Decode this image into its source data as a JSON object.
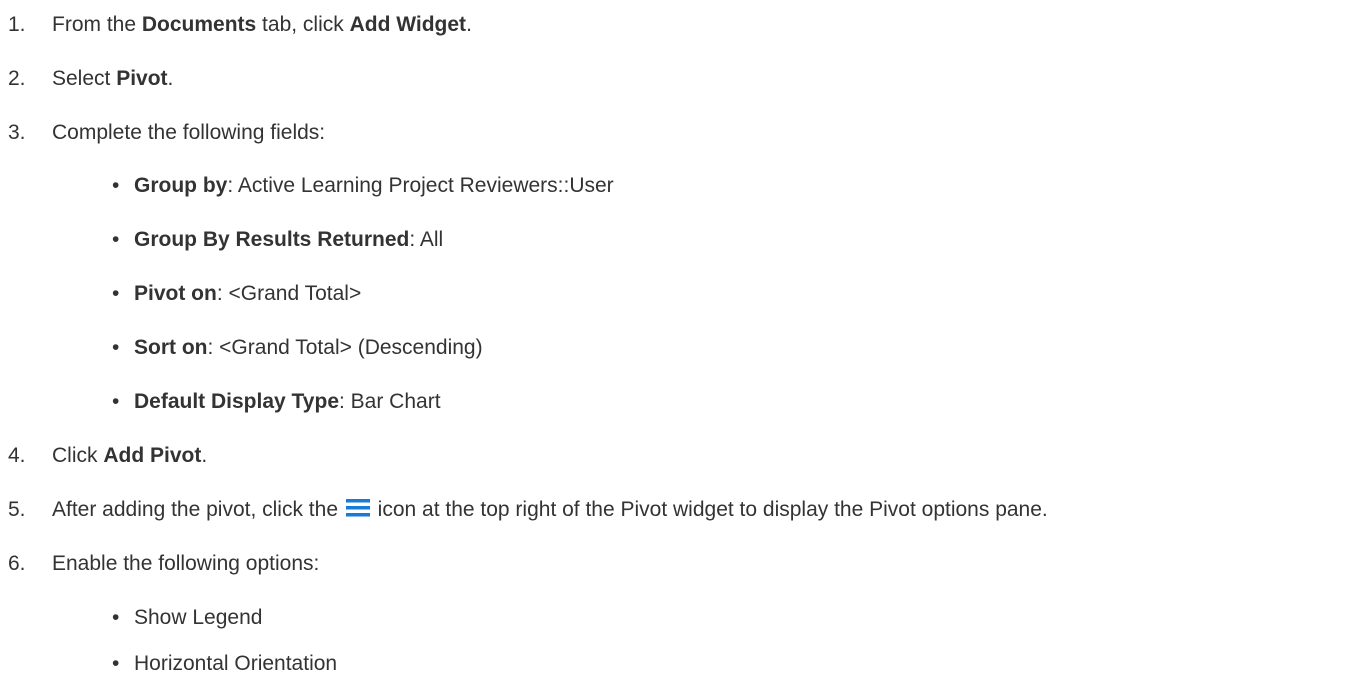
{
  "steps": [
    {
      "num": "1.",
      "p1": "From the ",
      "b1": "Documents",
      "p2": " tab, click ",
      "b2": "Add Widget",
      "p3": "."
    },
    {
      "num": "2.",
      "p1": "Select ",
      "b1": "Pivot",
      "p2": "."
    },
    {
      "num": "3.",
      "p1": "Complete the following fields:"
    },
    {
      "num": "4.",
      "p1": "Click ",
      "b1": "Add Pivot",
      "p2": "."
    },
    {
      "num": "5.",
      "p1": "After adding the pivot, click the ",
      "p2": " icon at the top right of the Pivot widget to display the Pivot options pane."
    },
    {
      "num": "6.",
      "p1": "Enable the following options:"
    }
  ],
  "fields": [
    {
      "label": "Group by",
      "value": ": Active Learning Project Reviewers::User"
    },
    {
      "label": "Group By Results Returned",
      "value": ": All"
    },
    {
      "label": "Pivot on",
      "value": ": <Grand Total>"
    },
    {
      "label": "Sort on",
      "value": ": <Grand Total> (Descending)"
    },
    {
      "label": "Default Display Type",
      "value": ": Bar Chart"
    }
  ],
  "options": [
    "Show Legend",
    "Horizontal Orientation"
  ],
  "bullet_char": "•",
  "icons": {
    "menu": "menu-icon"
  },
  "colors": {
    "text": "#333333",
    "menu_icon": "#1a7bd6"
  }
}
